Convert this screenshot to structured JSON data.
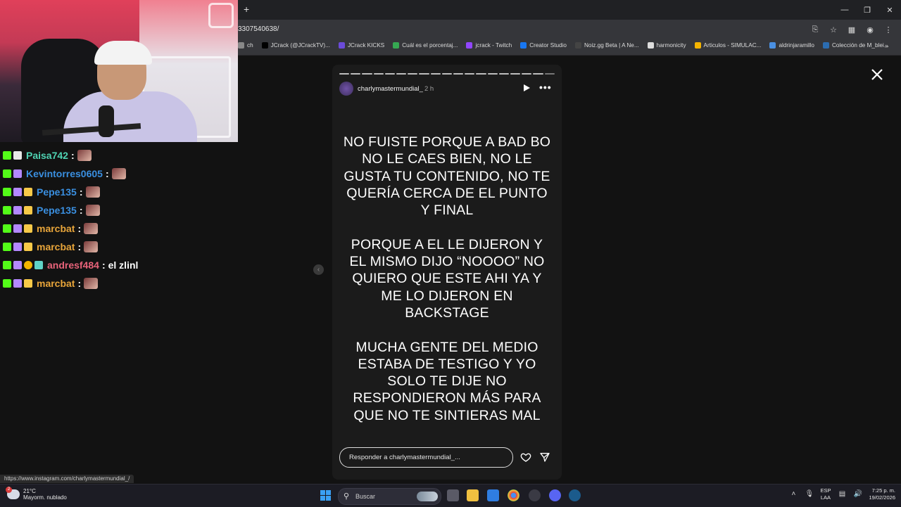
{
  "browser": {
    "url": "3307540638/",
    "new_tab_icon": "plus-icon",
    "window_controls": [
      "minimize-icon",
      "restore-icon",
      "close-icon"
    ],
    "bookmarks": [
      {
        "label": "ch",
        "icon": "bookmark-icon",
        "color": "#888888"
      },
      {
        "label": "JCrack (@JCrackTV)...",
        "icon": "x-icon",
        "color": "#000000"
      },
      {
        "label": "JCrack KICKS",
        "icon": "kick-icon",
        "color": "#6b4bd9"
      },
      {
        "label": "Cuál es el porcentaj...",
        "icon": "google-icon",
        "color": "#36a852"
      },
      {
        "label": "jcrack - Twitch",
        "icon": "twitch-icon",
        "color": "#9146ff"
      },
      {
        "label": "Creator Studio",
        "icon": "facebook-icon",
        "color": "#1877f2"
      },
      {
        "label": "Noiz.gg Beta | A Ne...",
        "icon": "noiz-icon",
        "color": "#444444"
      },
      {
        "label": "harmonicity",
        "icon": "notion-icon",
        "color": "#dddddd"
      },
      {
        "label": "Articulos - SIMULAC...",
        "icon": "drive-icon",
        "color": "#f4b400"
      },
      {
        "label": "aldrinjaramillo",
        "icon": "table-icon",
        "color": "#4a90e2"
      },
      {
        "label": "Colección de M_blei...",
        "icon": "globe-icon",
        "color": "#2b6cb0"
      }
    ],
    "bookmarks_more": "»",
    "status_url": "https://www.instagram.com/charlymastermundial_/"
  },
  "chat": {
    "messages": [
      {
        "badges": [
          "b-k",
          "b-x"
        ],
        "user": "Paisa742",
        "color": "#4fd3b3",
        "text": "",
        "emote": true
      },
      {
        "badges": [
          "b-k",
          "b-mod"
        ],
        "user": "Kevintorres0605",
        "color": "#3a8fe0",
        "text": "",
        "emote": true
      },
      {
        "badges": [
          "b-k",
          "b-mod",
          "b-crown"
        ],
        "user": "Pepe135",
        "color": "#3a8fe0",
        "text": "",
        "emote": true
      },
      {
        "badges": [
          "b-k",
          "b-mod",
          "b-crown"
        ],
        "user": "Pepe135",
        "color": "#3a8fe0",
        "text": "",
        "emote": true
      },
      {
        "badges": [
          "b-k",
          "b-mod",
          "b-crown"
        ],
        "user": "marcbat",
        "color": "#e8a53a",
        "text": "",
        "emote": true
      },
      {
        "badges": [
          "b-k",
          "b-mod",
          "b-crown"
        ],
        "user": "marcbat",
        "color": "#e8a53a",
        "text": "",
        "emote": true
      },
      {
        "badges": [
          "b-k",
          "b-mod",
          "b-one",
          "b-sub"
        ],
        "user": "andresf484",
        "color": "#e8637a",
        "text": "el zlinl",
        "emote": false
      },
      {
        "badges": [
          "b-k",
          "b-mod",
          "b-crown"
        ],
        "user": "marcbat",
        "color": "#e8a53a",
        "text": "",
        "emote": true
      }
    ]
  },
  "story": {
    "username": "charlymastermundial_",
    "time": "2 h",
    "segments": 19,
    "current_segment": 19,
    "paragraphs": [
      "NO FUISTE PORQUE A BAD BO NO LE CAES BIEN, NO LE GUSTA TU CONTENIDO, NO TE QUERÍA CERCA DE EL PUNTO Y FINAL",
      "PORQUE A EL LE DIJERON Y EL MISMO DIJO “NOOOO” NO QUIERO QUE ESTE AHI YA Y ME LO DIJERON EN BACKSTAGE",
      "MUCHA GENTE DEL MEDIO ESTABA DE TESTIGO Y YO SOLO TE DIJE NO RESPONDIERON MÁS PARA QUE NO TE SINTIERAS MAL"
    ],
    "reply_placeholder": "Responder a charlymastermundial_...",
    "more_label": "•••"
  },
  "taskbar": {
    "weather_temp": "21°C",
    "weather_desc": "Mayorm. nublado",
    "weather_badge": "2",
    "search_placeholder": "Buscar",
    "lang_top": "ESP",
    "lang_bottom": "LAA",
    "time": "7:25 p. m.",
    "date": "19/02/2026"
  }
}
